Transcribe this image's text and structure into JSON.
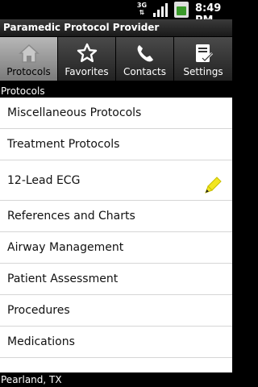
{
  "status": {
    "network": "3G",
    "time": "8:49 PM"
  },
  "app": {
    "title": "Paramedic Protocol Provider"
  },
  "tabs": [
    {
      "label": "Protocols",
      "icon": "home-icon",
      "active": true
    },
    {
      "label": "Favorites",
      "icon": "star-icon",
      "active": false
    },
    {
      "label": "Contacts",
      "icon": "phone-icon",
      "active": false
    },
    {
      "label": "Settings",
      "icon": "checklist-icon",
      "active": false
    }
  ],
  "section": {
    "title": "Protocols"
  },
  "items": [
    {
      "label": "Miscellaneous Protocols"
    },
    {
      "label": "Treatment Protocols"
    },
    {
      "label": "12-Lead ECG",
      "icon": "pencil-icon"
    },
    {
      "label": "References and Charts"
    },
    {
      "label": "Airway Management"
    },
    {
      "label": "Patient Assessment"
    },
    {
      "label": "Procedures"
    },
    {
      "label": "Medications"
    }
  ],
  "footer": {
    "location": "Pearland, TX"
  },
  "colors": {
    "active_tab": "#9a9a9a",
    "inactive_tab": "#333333",
    "pencil": "#f2e61f",
    "battery": "#3a9a2a"
  }
}
